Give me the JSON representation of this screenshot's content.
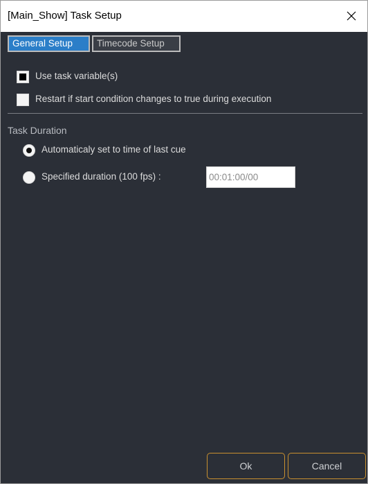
{
  "window": {
    "title": "[Main_Show] Task Setup",
    "close_icon": "close-icon"
  },
  "tabs": [
    {
      "label": "General Setup",
      "active": true
    },
    {
      "label": "Timecode Setup",
      "active": false
    }
  ],
  "options": {
    "use_task_variable": {
      "label": "Use task variable(s)",
      "checked": true
    },
    "restart_if_true": {
      "label": "Restart if start condition changes to true during execution",
      "checked": false
    }
  },
  "task_duration": {
    "section_title": "Task Duration",
    "auto_label": "Automaticaly set to time of last cue",
    "auto_selected": true,
    "specified_label": "Specified duration (100 fps) :",
    "specified_selected": false,
    "duration_value": "00:01:00/00"
  },
  "buttons": {
    "ok": "Ok",
    "cancel": "Cancel"
  },
  "colors": {
    "background": "#2b2f37",
    "tab_active": "#2b7ec8",
    "button_border": "#c9902f"
  }
}
